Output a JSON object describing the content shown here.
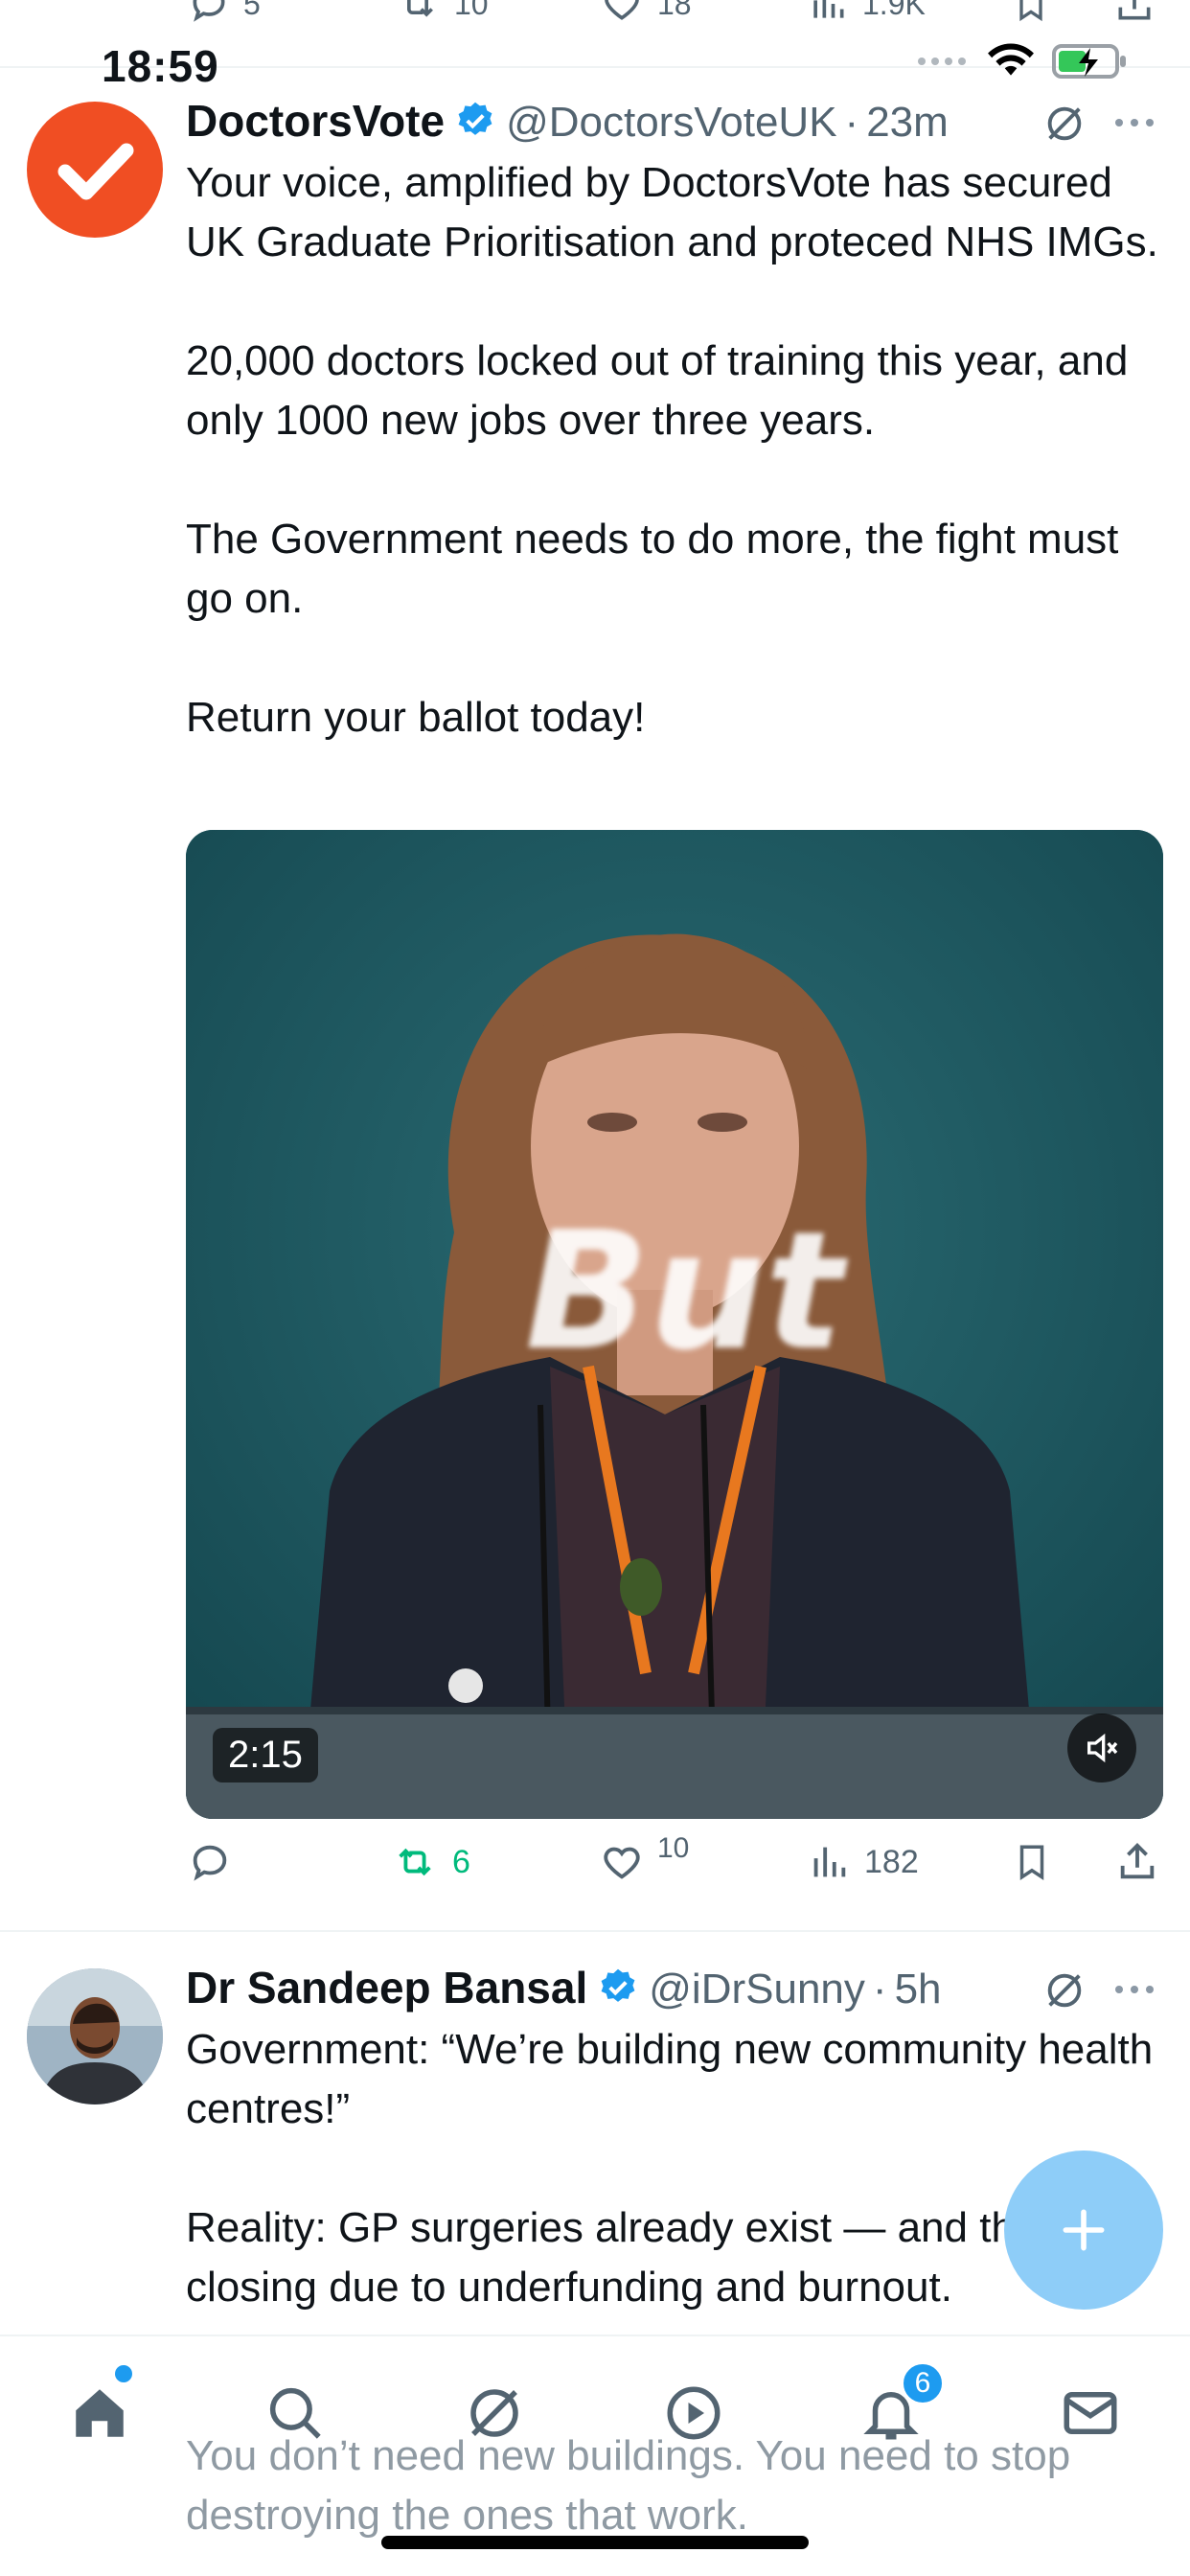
{
  "status_bar": {
    "time": "18:59"
  },
  "top_partial_actions": {
    "replies": "5",
    "reposts": "10",
    "likes": "18",
    "views": "1.9K"
  },
  "tweets": [
    {
      "name": "DoctorsVote",
      "handle": "@DoctorsVoteUK",
      "time": "23m",
      "paragraphs": [
        "Your voice, amplified by DoctorsVote has secured UK Graduate Prioritisation and proteced NHS IMGs.",
        "20,000 doctors locked out of training this year, and only 1000 new jobs over three years.",
        "The Government needs to do more, the fight must go on.",
        "Return your ballot today!"
      ],
      "video": {
        "duration": "2:15",
        "caption_overlay": "But"
      },
      "actions": {
        "replies": "",
        "reposts": "6",
        "likes": "10",
        "views": "182"
      }
    },
    {
      "name": "Dr Sandeep Bansal",
      "handle": "@iDrSunny",
      "time": "5h",
      "paragraphs": [
        "Government: “We’re building new community health centres!”",
        "Reality: GP surgeries already exist — and they’re closing due to underfunding and burnout."
      ],
      "behind_nav_text": "You don’t need new buildings. You need to stop destroying the ones that work."
    }
  ],
  "nav": {
    "notifications_badge": "6"
  },
  "colors": {
    "accent": "#1d9bf0",
    "repost_active": "#00ba7c",
    "doctorsvote_brand": "#f04e23"
  }
}
